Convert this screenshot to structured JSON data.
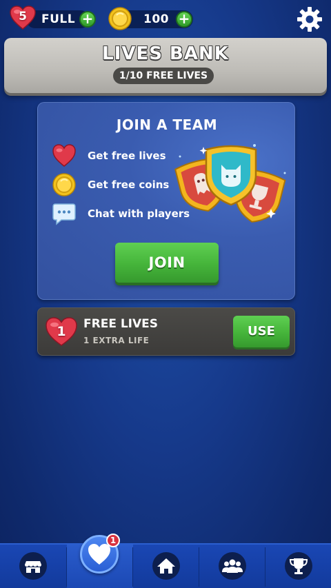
{
  "topbar": {
    "lives_count": "5",
    "lives_status": "FULL",
    "coins": "100"
  },
  "banner": {
    "title": "LIVES BANK",
    "subtitle": "1/10 FREE LIVES"
  },
  "team_card": {
    "title": "JOIN A TEAM",
    "features": [
      {
        "icon": "heart-icon",
        "label": "Get free lives"
      },
      {
        "icon": "coin-icon",
        "label": "Get free coins"
      },
      {
        "icon": "chat-icon",
        "label": "Chat with players"
      }
    ],
    "join_label": "JOIN"
  },
  "free_lives": {
    "count": "1",
    "title": "FREE LIVES",
    "subtitle": "1 EXTRA LIFE",
    "use_label": "USE"
  },
  "bottom_nav": {
    "items": [
      {
        "icon": "shop-icon"
      },
      {
        "icon": "lives-heart-icon",
        "badge": "1"
      },
      {
        "icon": "home-icon"
      },
      {
        "icon": "team-icon"
      },
      {
        "icon": "trophy-icon"
      }
    ]
  },
  "colors": {
    "background": "#16398a",
    "green_button": "#45b43a",
    "heart_red": "#e0394a",
    "coin_gold": "#f2c21d",
    "banner_gray": "#bebcb7"
  }
}
